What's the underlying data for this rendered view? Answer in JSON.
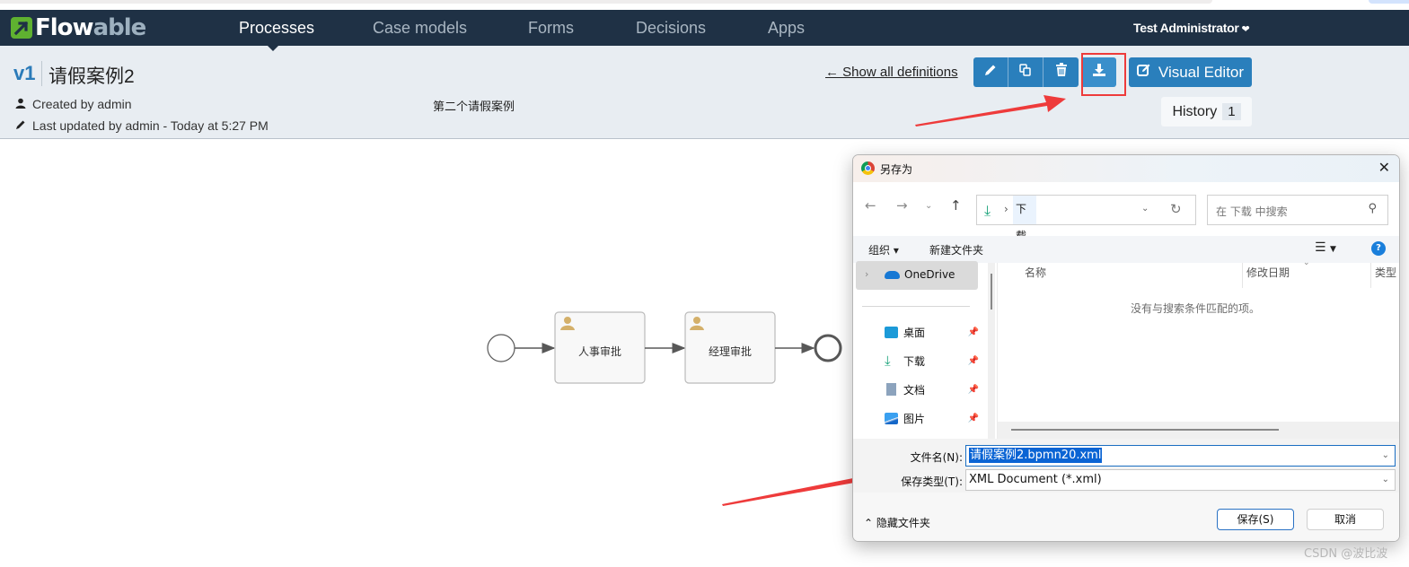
{
  "app": {
    "logo_part1": "Flow",
    "logo_part2": "able"
  },
  "nav": {
    "items": [
      {
        "label": "Processes",
        "active": true
      },
      {
        "label": "Case models",
        "active": false
      },
      {
        "label": "Forms",
        "active": false
      },
      {
        "label": "Decisions",
        "active": false
      },
      {
        "label": "Apps",
        "active": false
      }
    ],
    "user": "Test Administrator"
  },
  "header": {
    "version": "v1",
    "title": "请假案例2",
    "created_by": "Created by admin",
    "last_updated": "Last updated by admin - Today at 5:27 PM",
    "description": "第二个请假案例",
    "show_all": "← Show all definitions",
    "visual_editor": "Visual Editor",
    "history_label": "History",
    "history_count": "1",
    "action_icons": [
      "pencil-icon",
      "copy-icon",
      "trash-icon",
      "download-icon"
    ]
  },
  "diagram": {
    "tasks": [
      {
        "label": "人事审批",
        "type": "user-task"
      },
      {
        "label": "经理审批",
        "type": "user-task"
      }
    ],
    "task_icon_color": "#d4b06a"
  },
  "dialog": {
    "title": "另存为",
    "address_crumb": "下载",
    "search_placeholder": "在 下载 中搜索",
    "toolbar_organize": "组织 ▾",
    "toolbar_new_folder": "新建文件夹",
    "sidebar": {
      "onedrive": "OneDrive",
      "quick": [
        {
          "label": "桌面",
          "icon": "desktop-icon"
        },
        {
          "label": "下载",
          "icon": "download-icon"
        },
        {
          "label": "文档",
          "icon": "document-icon"
        },
        {
          "label": "图片",
          "icon": "picture-icon"
        }
      ]
    },
    "columns": [
      "名称",
      "修改日期",
      "类型"
    ],
    "empty_message": "没有与搜索条件匹配的项。",
    "filename_label": "文件名(N):",
    "filename_value": "请假案例2.bpmn20.xml",
    "filetype_label": "保存类型(T):",
    "filetype_value": "XML Document (*.xml)",
    "hide_folders": "隐藏文件夹",
    "save": "保存(S)",
    "cancel": "取消"
  },
  "watermark": "CSDN @波比波",
  "colors": {
    "navbar": "#1f3145",
    "accent": "#2a7fbc",
    "highlight": "#ee3b3b",
    "brand_green": "#5fb130"
  }
}
